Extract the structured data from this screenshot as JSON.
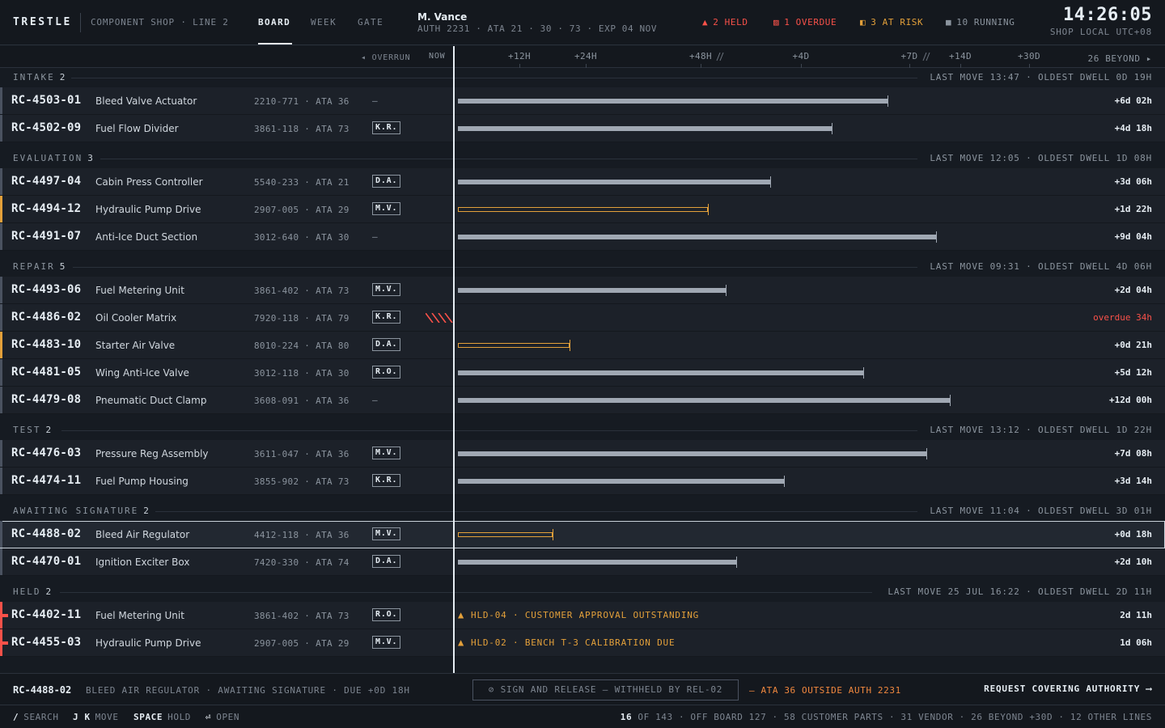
{
  "header": {
    "brand": "TRESTLE",
    "shop": "COMPONENT SHOP · LINE 2",
    "tabs": [
      {
        "label": "BOARD",
        "active": true
      },
      {
        "label": "WEEK",
        "active": false
      },
      {
        "label": "GATE",
        "active": false
      }
    ],
    "user": {
      "name": "M. Vance",
      "auth": "AUTH 2231 · ATA 21 · 30 · 73 · EXP 04 NOV"
    },
    "stats": [
      {
        "icon": "warning-triangle-icon",
        "glyph": "▲",
        "label": "2 HELD",
        "color": "#f85149"
      },
      {
        "icon": "overdue-box-icon",
        "glyph": "▨",
        "label": "1 OVERDUE",
        "color": "#f85149"
      },
      {
        "icon": "at-risk-box-icon",
        "glyph": "◧",
        "label": "3 AT RISK",
        "color": "#e3a03a"
      },
      {
        "icon": "running-square-icon",
        "glyph": "■",
        "label": "10 RUNNING",
        "color": "#8b949e"
      }
    ],
    "clock": "14:26:05",
    "clock_sub": "SHOP LOCAL UTC+08"
  },
  "axis": {
    "overrun": "◂ OVERRUN",
    "now": "NOW",
    "ticks": [
      "+12H",
      "+24H",
      "+48H",
      "+4D",
      "+7D",
      "+14D",
      "+30D"
    ],
    "beyond": "26 BEYOND ▸"
  },
  "groups": [
    {
      "title": "INTAKE",
      "count": "2",
      "meta": "LAST MOVE 13:47 · OLDEST DWELL 0D 19H",
      "rows": [
        {
          "rc": "RC-4503-01",
          "name": "Bleed Valve Actuator",
          "pn": "2210-771 · ATA 36",
          "tech": "",
          "edge": "grey",
          "bar": 1097,
          "bar_style": "solid",
          "time": "+6d 02h"
        },
        {
          "rc": "RC-4502-09",
          "name": "Fuel Flow Divider",
          "pn": "3861-118 · ATA 73",
          "tech": "K.R.",
          "edge": "grey",
          "bar": 1028,
          "bar_style": "solid",
          "time": "+4d 18h"
        }
      ]
    },
    {
      "title": "EVALUATION",
      "count": "3",
      "meta": "LAST MOVE 12:05 · OLDEST DWELL 1D 08H",
      "rows": [
        {
          "rc": "RC-4497-04",
          "name": "Cabin Press Controller",
          "pn": "5540-233 · ATA 21",
          "tech": "D.A.",
          "edge": "grey",
          "bar": 952,
          "bar_style": "solid",
          "time": "+3d 06h"
        },
        {
          "rc": "RC-4494-12",
          "name": "Hydraulic Pump Drive",
          "pn": "2907-005 · ATA 29",
          "tech": "M.V.",
          "edge": "amber",
          "bar": 875,
          "bar_style": "amber",
          "time": "+1d 22h"
        },
        {
          "rc": "RC-4491-07",
          "name": "Anti-Ice Duct Section",
          "pn": "3012-640 · ATA 30",
          "tech": "",
          "edge": "grey",
          "bar": 1157,
          "bar_style": "solid",
          "time": "+9d 04h"
        }
      ]
    },
    {
      "title": "REPAIR",
      "count": "5",
      "meta": "LAST MOVE 09:31 · OLDEST DWELL 4D 06H",
      "rows": [
        {
          "rc": "RC-4493-06",
          "name": "Fuel Metering Unit",
          "pn": "3861-402 · ATA 73",
          "tech": "M.V.",
          "edge": "grey",
          "bar": 897,
          "bar_style": "solid",
          "time": "+2d 04h"
        },
        {
          "rc": "RC-4486-02",
          "name": "Oil Cooler Matrix",
          "pn": "7920-118 · ATA 79",
          "tech": "K.R.",
          "edge": "grey",
          "bar": 0,
          "bar_style": "overrun",
          "time": "overdue 34h"
        },
        {
          "rc": "RC-4483-10",
          "name": "Starter Air Valve",
          "pn": "8010-224 · ATA 80",
          "tech": "D.A.",
          "edge": "amber",
          "bar": 704,
          "bar_style": "amber",
          "time": "+0d 21h"
        },
        {
          "rc": "RC-4481-05",
          "name": "Wing Anti-Ice Valve",
          "pn": "3012-118 · ATA 30",
          "tech": "R.O.",
          "edge": "grey",
          "bar": 1067,
          "bar_style": "solid",
          "time": "+5d 12h"
        },
        {
          "rc": "RC-4479-08",
          "name": "Pneumatic Duct Clamp",
          "pn": "3608-091 · ATA 36",
          "tech": "",
          "edge": "grey",
          "bar": 1174,
          "bar_style": "solid",
          "time": "+12d 00h"
        }
      ]
    },
    {
      "title": "TEST",
      "count": "2",
      "meta": "LAST MOVE 13:12 · OLDEST DWELL 1D 22H",
      "rows": [
        {
          "rc": "RC-4476-03",
          "name": "Pressure Reg Assembly",
          "pn": "3611-047 · ATA 36",
          "tech": "M.V.",
          "edge": "grey",
          "bar": 1145,
          "bar_style": "solid",
          "time": "+7d 08h"
        },
        {
          "rc": "RC-4474-11",
          "name": "Fuel Pump Housing",
          "pn": "3855-902 · ATA 73",
          "tech": "K.R.",
          "edge": "grey",
          "bar": 969,
          "bar_style": "solid",
          "time": "+3d 14h"
        }
      ]
    },
    {
      "title": "AWAITING SIGNATURE",
      "count": "2",
      "meta": "LAST MOVE 11:04 · OLDEST DWELL 3D 01H",
      "rows": [
        {
          "rc": "RC-4488-02",
          "name": "Bleed Air Regulator",
          "pn": "4412-118 · ATA 36",
          "tech": "M.V.",
          "edge": "grey",
          "bar": 683,
          "bar_style": "amber",
          "time": "+0d 18h",
          "selected": true
        },
        {
          "rc": "RC-4470-01",
          "name": "Ignition Exciter Box",
          "pn": "7420-330 · ATA 74",
          "tech": "D.A.",
          "edge": "grey",
          "bar": 910,
          "bar_style": "solid",
          "time": "+2d 10h"
        }
      ]
    },
    {
      "title": "HELD",
      "count": "2",
      "meta": "LAST MOVE 25 JUL 16:22 · OLDEST DWELL 2D 11H",
      "rows": [
        {
          "rc": "RC-4402-11",
          "name": "Fuel Metering Unit",
          "pn": "3861-402 · ATA 73",
          "tech": "R.O.",
          "edge": "red",
          "bar": 0,
          "bar_style": "hold",
          "hold": "HLD-04 · CUSTOMER APPROVAL OUTSTANDING",
          "time": "2d 11h"
        },
        {
          "rc": "RC-4455-03",
          "name": "Hydraulic Pump Drive",
          "pn": "2907-005 · ATA 29",
          "tech": "M.V.",
          "edge": "red",
          "bar": 0,
          "bar_style": "hold",
          "hold": "HLD-02 · BENCH T-3 CALIBRATION DUE",
          "time": "1d 06h"
        }
      ]
    }
  ],
  "action_bar": {
    "rc": "RC-4488-02",
    "desc": "BLEED AIR REGULATOR · AWAITING SIGNATURE · DUE +0D 18H",
    "button": "⊘ SIGN AND RELEASE — WITHHELD BY REL-02",
    "warning": "— ATA 36 OUTSIDE AUTH 2231",
    "link": "REQUEST COVERING AUTHORITY ⟶"
  },
  "status_bar": {
    "shortcuts": [
      {
        "key": "/",
        "label": "SEARCH"
      },
      {
        "key": "J K",
        "label": "MOVE"
      },
      {
        "key": "SPACE",
        "label": "HOLD"
      },
      {
        "key": "⏎",
        "label": "OPEN"
      }
    ],
    "count_strong": "16",
    "count_rest": "OF 143 · OFF BOARD 127 · 58 CUSTOMER PARTS · 31 VENDOR · 26 BEYOND +30D · 12 OTHER LINES"
  }
}
